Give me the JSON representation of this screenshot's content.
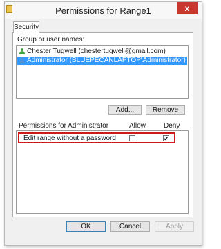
{
  "window": {
    "title": "Permissions for Range1",
    "close_glyph": "x"
  },
  "tabs": [
    {
      "label": "Security",
      "active": true
    }
  ],
  "group_label": "Group or user names:",
  "users": [
    {
      "name": "Chester Tugwell (chestertugwell@gmail.com)",
      "icon": "user-icon",
      "selected": false
    },
    {
      "name": "Administrator (BLUEPECANLAPTOP\\Administrator)",
      "icon": "user-icon",
      "selected": true
    }
  ],
  "buttons": {
    "add": "Add...",
    "remove": "Remove",
    "ok": "OK",
    "cancel": "Cancel",
    "apply": "Apply"
  },
  "permissions": {
    "header": "Permissions for Administrator",
    "allow_label": "Allow",
    "deny_label": "Deny",
    "rows": [
      {
        "name": "Edit range without a password",
        "allow": false,
        "deny": true,
        "check_glyph": "✔"
      }
    ]
  },
  "colors": {
    "selection": "#3399ff",
    "highlight_border": "#cc1a1a",
    "close_button": "#c7372d"
  }
}
